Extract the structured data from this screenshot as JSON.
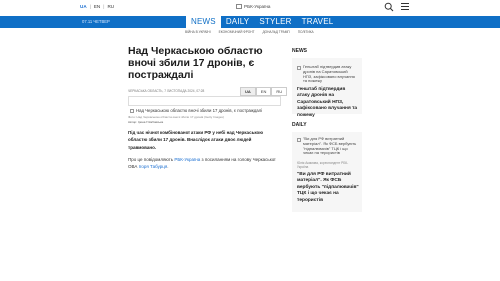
{
  "header": {
    "languages": [
      "UA",
      "EN",
      "RU"
    ],
    "active_language": "UA",
    "logo_text": "РБК-Україна",
    "search_icon": "search-icon",
    "menu_icon": "hamburger-menu-icon"
  },
  "nav": {
    "date": "07.11 ЧЕТВЕР",
    "tabs": [
      "NEWS",
      "DAILY",
      "STYLER",
      "TRAVEL"
    ],
    "active_tab": "NEWS",
    "subnav": [
      "ВІЙНА В УКРАЇНІ",
      "ЕКОНОМІЧНИЙ ФРОНТ",
      "ДОНАЛЬД ТРАМП",
      "ПОЛІТИКА"
    ],
    "accent_color": "#0f6fc6"
  },
  "article": {
    "title": "Над Черкаською областю вночі збили 17 дронів, є постраждалі",
    "meta": "ЧЕРКАСЬКА ОБЛАСТЬ, 7 ЛИСТОПАДА 2024, 07:28",
    "lang_switch": [
      "UA",
      "EN",
      "RU"
    ],
    "lang_switch_active": "UA",
    "image_caption": "Над Черкаською областю вночі збили 17 дронів, є постраждалі",
    "image_source": "Фото: Над Черкаською областю вночі збили 17 дронів (Getty Images)",
    "author": "Автор: Ірина Глімбовська",
    "lead": "Під час нічної комбінованої атаки РФ у небі над Черкаською областю збили 17 дронів. Внаслідок атаки двоє людей травмовано.",
    "body_prefix": "Про це повідомляють ",
    "body_link1": "РБК-Україна",
    "body_middle": " з посиланням на голову Черкаської ОВА ",
    "body_link2": "Ігоря Табурця",
    "body_suffix": ".",
    "link_color": "#1b6fd1"
  },
  "sidebar": {
    "news_heading": "NEWS",
    "news_card": {
      "image_alt": "Генштаб підтвердив атаку дронів на Саратовський НПЗ, зафіксовано влучання та пожежу",
      "headline": "Генштаб підтвердив атаку дронів на Саратовський НПЗ, зафіксовано влучання та пожежу"
    },
    "daily_heading": "DAILY",
    "daily_card": {
      "image_alt": "\"Ви для РФ витратний матеріал\". Як ФСБ вербують \"підпалювачів\" ТЦК і що чекає на терористів",
      "byline": "Юлія Акимова, кореспондент РБК-Україна",
      "headline": "\"Ви для РФ витратний матеріал\". Як ФСБ вербують \"підпалювачів\" ТЦК і що чекає на терористів"
    }
  }
}
